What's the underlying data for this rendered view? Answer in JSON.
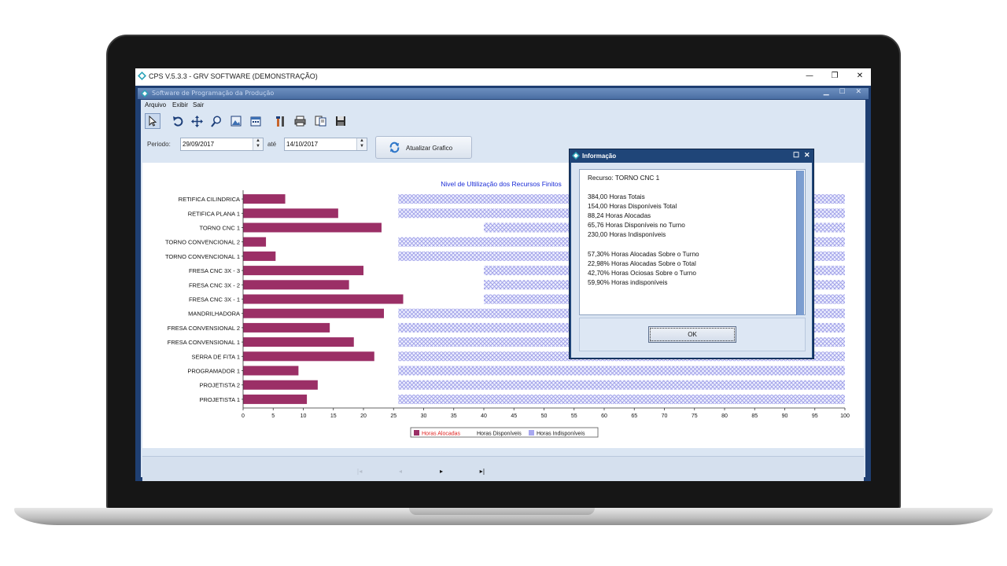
{
  "window": {
    "title": "CPS V.5.3.3 - GRV SOFTWARE (DEMONSTRAÇÃO)",
    "controls": {
      "minimize": "—",
      "restore": "❐",
      "close": "✕"
    }
  },
  "mdi": {
    "title": "Software de Programação da Produção",
    "controls": "▁ ☐ ✕"
  },
  "menu": {
    "items": [
      "Arquivo",
      "Exibir",
      "Sair"
    ]
  },
  "toolbar": {
    "icons": [
      "pointer-icon",
      "undo-icon",
      "move-icon",
      "zoom-icon",
      "export-image-icon",
      "calendar-icon",
      "settings-icon",
      "print-icon",
      "print-preview-icon",
      "save-icon"
    ]
  },
  "filters": {
    "period_label": "Periodo:",
    "start_date": "29/09/2017",
    "until_label": "até",
    "end_date": "14/10/2017",
    "refresh_label": "Atualizar Grafico"
  },
  "nav": {
    "first": "|◂",
    "prev": "◂",
    "next": "▸",
    "last": "▸|"
  },
  "chart_data": {
    "type": "bar",
    "orientation": "horizontal",
    "title": "Nivel de Ultilização dos Recursos Finitos",
    "categories": [
      "RETIFICA CILINDRICA",
      "RETIFICA PLANA 1",
      "TORNO CNC 1",
      "TORNO CONVENCIONAL 2",
      "TORNO CONVENCIONAL 1",
      "FRESA CNC 3X - 3",
      "FRESA CNC 3X - 2",
      "FRESA CNC 3X - 1",
      "MANDRILHADORA",
      "FRESA CONVENSIONAL 2",
      "FRESA CONVENSIONAL 1",
      "SERRA DE FITA 1",
      "PROGRAMADOR 1",
      "PROJETISTA 2",
      "PROJETISTA 1"
    ],
    "series": [
      {
        "name": "Horas Alocadas",
        "color": "#9b2f66",
        "values": [
          7,
          15.8,
          23,
          3.8,
          5.4,
          20,
          17.6,
          26.6,
          23.4,
          14.4,
          18.4,
          21.8,
          9.2,
          12.4,
          10.6
        ]
      },
      {
        "name": "Horas Disponíveis",
        "color": "#ffffff",
        "values": []
      },
      {
        "name": "Horas Indisponíveis",
        "color": "#a8a8f0",
        "start": [
          25.8,
          25.8,
          40,
          25.8,
          25.8,
          40,
          40,
          40,
          25.8,
          25.8,
          25.8,
          25.8,
          25.8,
          25.8,
          25.8
        ],
        "end": [
          100,
          100,
          100,
          100,
          100,
          100,
          100,
          100,
          100,
          100,
          100,
          100,
          100,
          100,
          100
        ]
      }
    ],
    "xlim": [
      0,
      100
    ],
    "xticks": [
      0,
      5,
      10,
      15,
      20,
      25,
      30,
      35,
      40,
      45,
      50,
      55,
      60,
      65,
      70,
      75,
      80,
      85,
      90,
      95,
      100
    ],
    "legend_position": "bottom-center",
    "title_color": "#1a2bd6",
    "legend_highlight_color": "#e0201e"
  },
  "dialog": {
    "title": "Informação",
    "resource": "Recurso: TORNO CNC 1",
    "lines_a": [
      "384,00 Horas Totais",
      "154,00 Horas Disponíveis Total",
      "88,24 Horas Alocadas",
      "65,76 Horas Disponíveis no Turno",
      "230,00 Horas Indisponíveis"
    ],
    "lines_b": [
      "57,30% Horas Alocadas Sobre o Turno",
      "22,98% Horas Alocadas Sobre o Total",
      "42,70% Horas Ociosas Sobre o Turno",
      "59,90% Horas indisponíveis"
    ],
    "ok_label": "OK"
  }
}
